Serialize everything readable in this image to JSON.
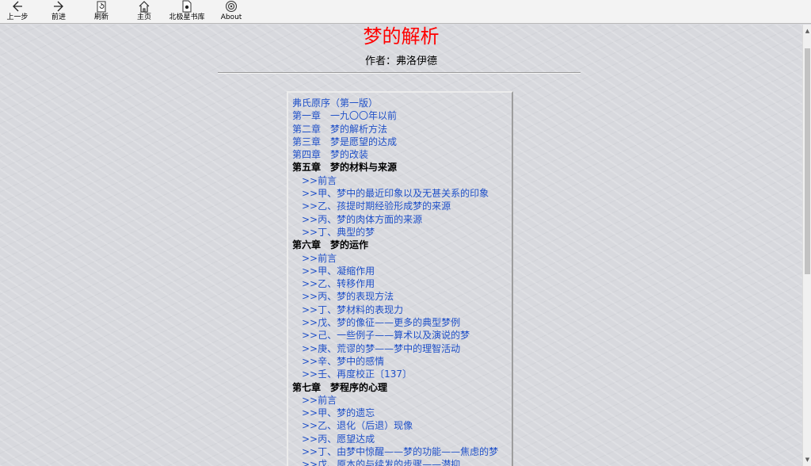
{
  "toolbar": {
    "back": {
      "label": "上一步",
      "icon": "arrow-left-icon"
    },
    "forward": {
      "label": "前进",
      "icon": "arrow-right-icon"
    },
    "refresh": {
      "label": "刷新",
      "icon": "refresh-icon"
    },
    "home": {
      "label": "主页",
      "icon": "home-icon"
    },
    "library": {
      "label": "北极星书库",
      "icon": "document-icon"
    },
    "about": {
      "label": "About",
      "icon": "info-icon"
    }
  },
  "page": {
    "title": "梦的解析",
    "author": "作者：弗洛伊德",
    "title_color": "#ff0000",
    "link_color": "#1f50c8"
  },
  "toc": [
    {
      "text": "弗氏原序（第一版）",
      "type": "link"
    },
    {
      "text": "第一章　一九〇〇年以前",
      "type": "link"
    },
    {
      "text": "第二章　梦的解析方法",
      "type": "link"
    },
    {
      "text": "第三章　梦是愿望的达成",
      "type": "link"
    },
    {
      "text": "第四章　梦的改装",
      "type": "link"
    },
    {
      "text": "第五章　梦的材料与来源",
      "type": "heading"
    },
    {
      "text": ">>前言",
      "type": "sub"
    },
    {
      "text": ">>甲、梦中的最近印象以及无甚关系的印象",
      "type": "sub"
    },
    {
      "text": ">>乙、孩提时期经验形成梦的来源",
      "type": "sub"
    },
    {
      "text": ">>丙、梦的肉体方面的来源",
      "type": "sub"
    },
    {
      "text": ">>丁、典型的梦",
      "type": "sub"
    },
    {
      "text": "第六章　梦的运作",
      "type": "heading"
    },
    {
      "text": ">>前言",
      "type": "sub"
    },
    {
      "text": ">>甲、凝缩作用",
      "type": "sub"
    },
    {
      "text": ">>乙、转移作用",
      "type": "sub"
    },
    {
      "text": ">>丙、梦的表现方法",
      "type": "sub"
    },
    {
      "text": ">>丁、梦材料的表现力",
      "type": "sub"
    },
    {
      "text": ">>戊、梦的像征——更多的典型梦例",
      "type": "sub"
    },
    {
      "text": ">>己、一些例子——算术以及演说的梦",
      "type": "sub"
    },
    {
      "text": ">>庚、荒谬的梦——梦中的理智活动",
      "type": "sub"
    },
    {
      "text": ">>辛、梦中的感情",
      "type": "sub"
    },
    {
      "text": ">>壬、再度校正〔137〕",
      "type": "sub"
    },
    {
      "text": "第七章　梦程序的心理",
      "type": "heading"
    },
    {
      "text": ">>前言",
      "type": "sub"
    },
    {
      "text": ">>甲、梦的遗忘",
      "type": "sub"
    },
    {
      "text": ">>乙、退化（后退）现像",
      "type": "sub"
    },
    {
      "text": ">>丙、愿望达成",
      "type": "sub"
    },
    {
      "text": ">>丁、由梦中惊醒——梦的功能——焦虑的梦",
      "type": "sub"
    },
    {
      "text": ">>戊、原本的与续发的步骤——潜抑",
      "type": "sub"
    }
  ]
}
